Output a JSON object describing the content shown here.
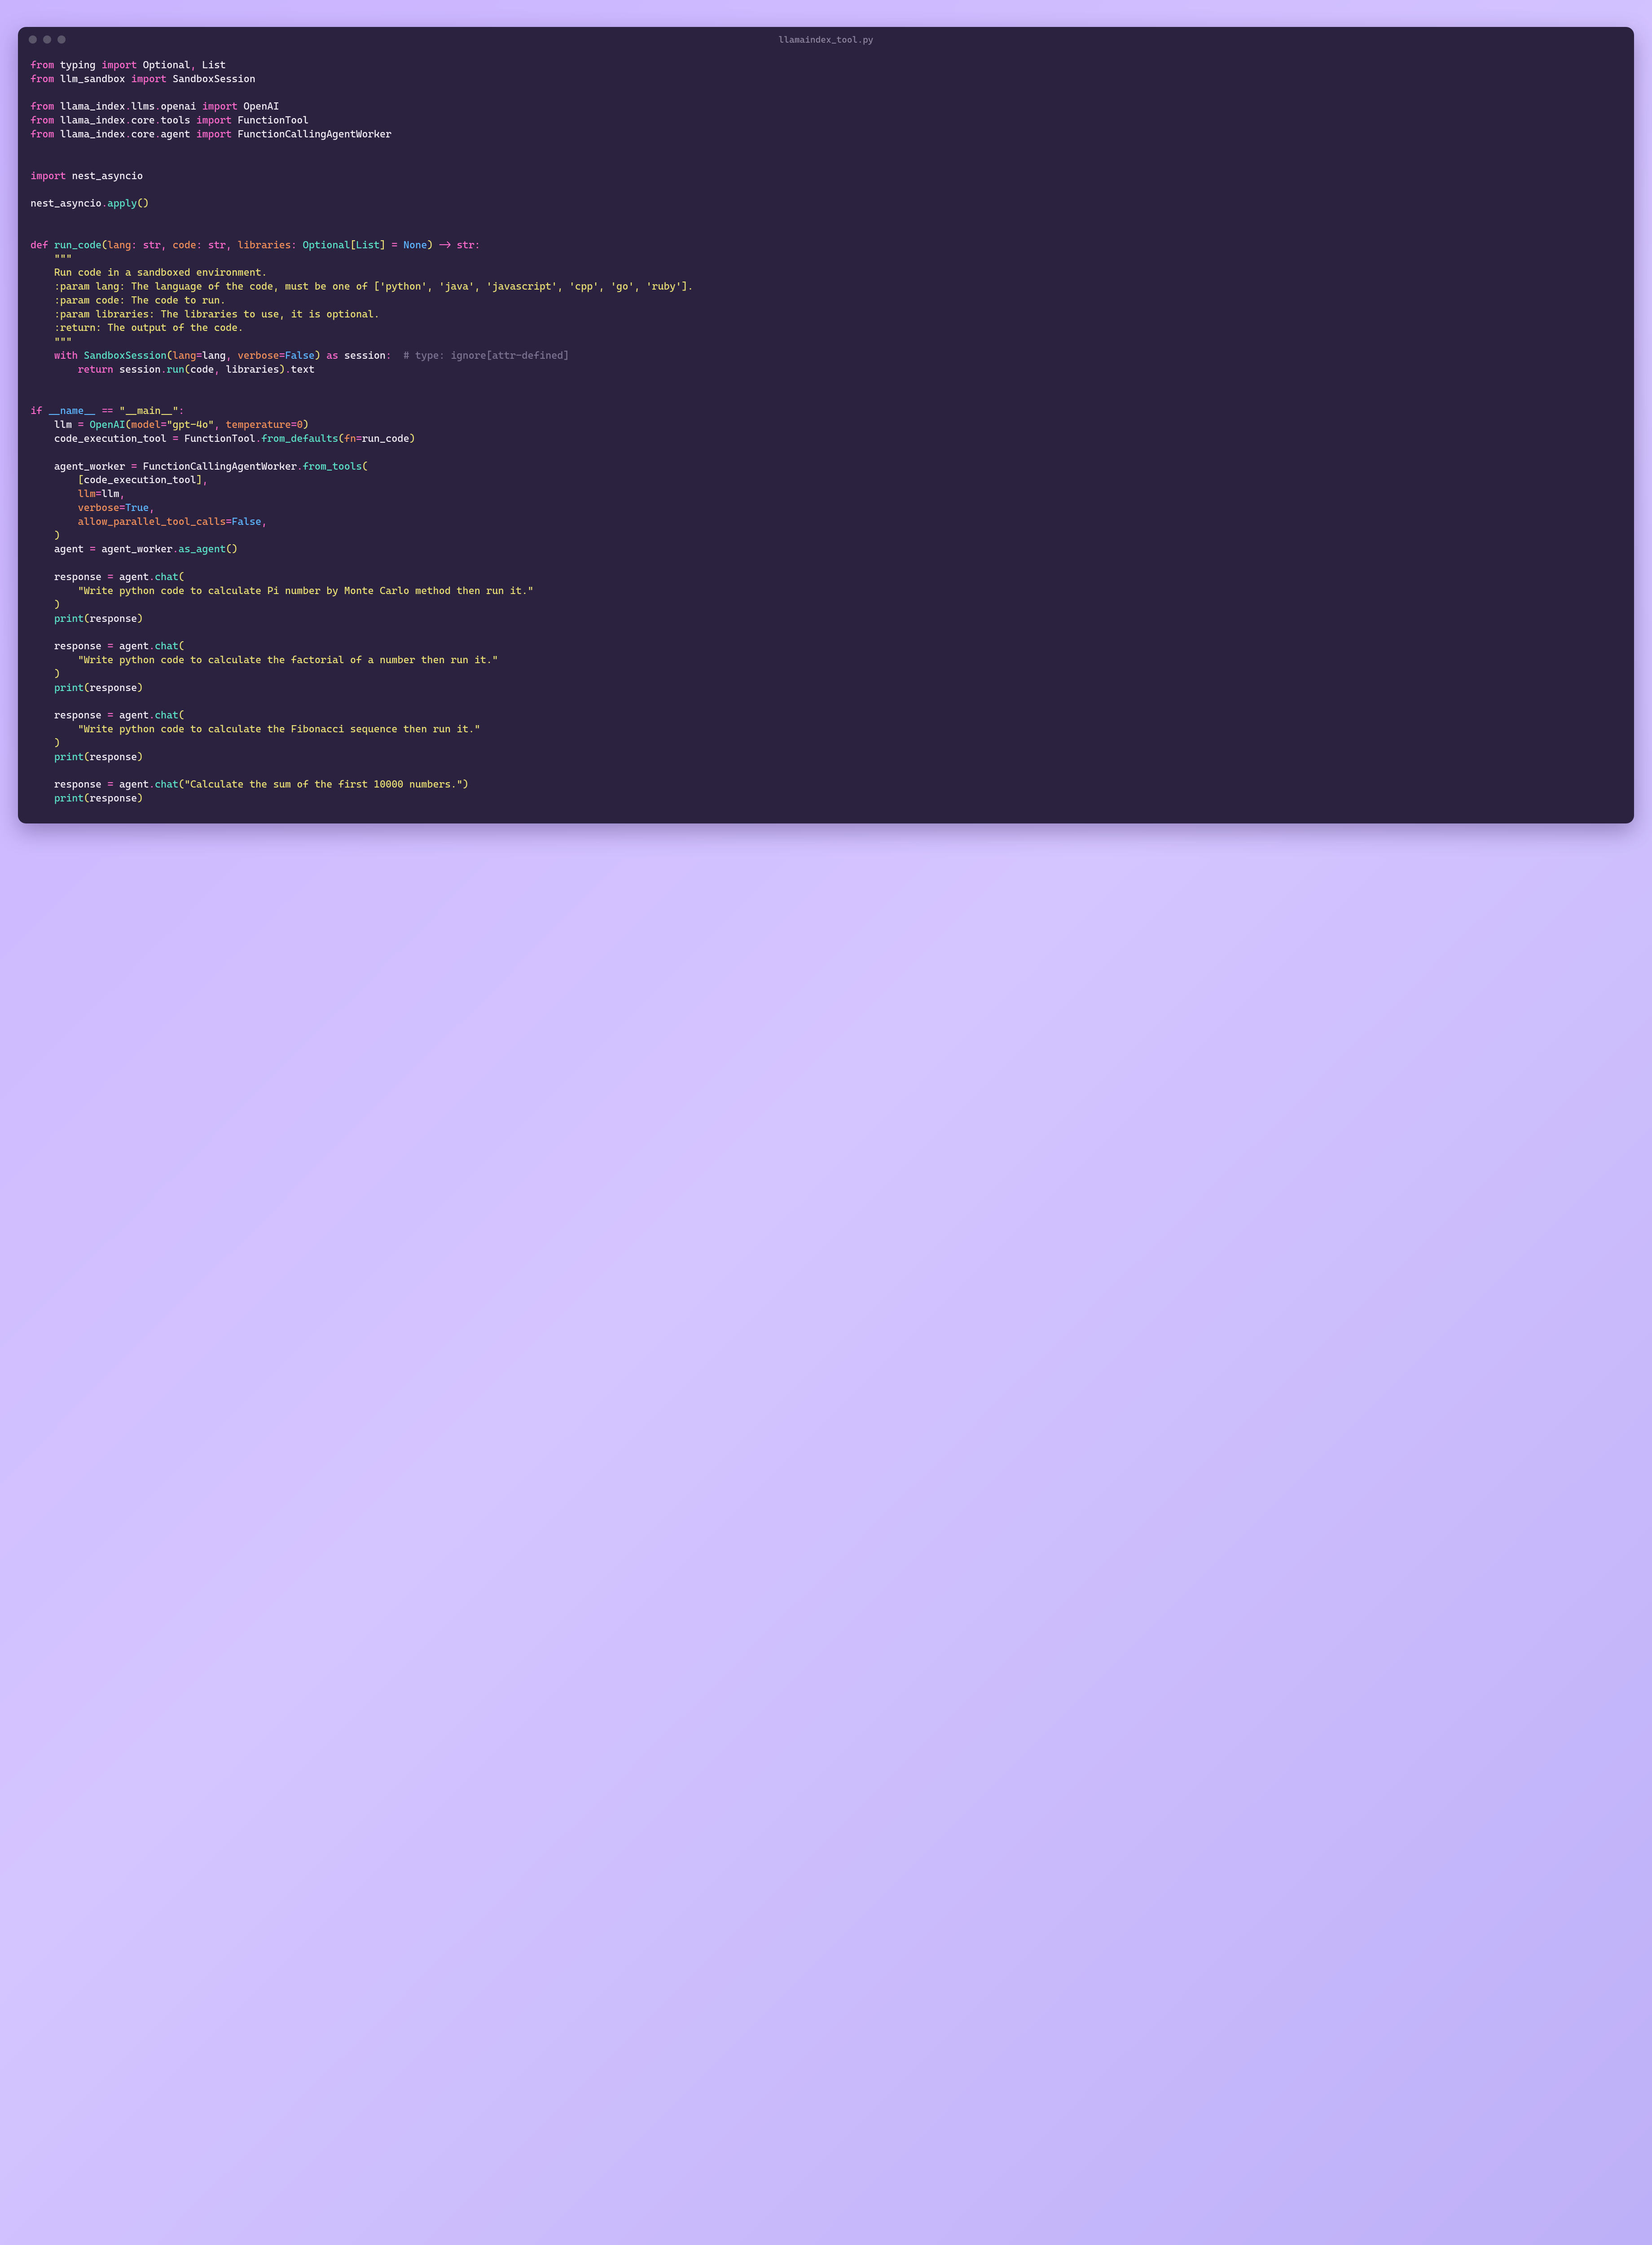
{
  "window": {
    "title": "llamaindex_tool.py"
  },
  "tokens": {
    "kw_from": "from",
    "kw_import": "import",
    "kw_def": "def",
    "kw_return": "return",
    "kw_with": "with",
    "kw_as": "as",
    "kw_if": "if",
    "typing": "typing",
    "Optional": "Optional",
    "List": "List",
    "llm_sandbox": "llm_sandbox",
    "SandboxSession": "SandboxSession",
    "llama_index": "llama_index",
    "llms": "llms",
    "openai_mod": "openai",
    "OpenAI": "OpenAI",
    "core": "core",
    "tools": "tools",
    "FunctionTool": "FunctionTool",
    "agent_mod": "agent",
    "FunctionCallingAgentWorker": "FunctionCallingAgentWorker",
    "nest_asyncio": "nest_asyncio",
    "apply": "apply",
    "run_code": "run_code",
    "lang": "lang",
    "code": "code",
    "libraries": "libraries",
    "builtin_str": "str",
    "None": "None",
    "doc1": "    Run code in a sandboxed environment.",
    "doc2": "    :param lang: The language of the code, must be one of ['python', 'java', 'javascript', 'cpp', 'go', 'ruby'].",
    "doc3": "    :param code: The code to run.",
    "doc4": "    :param libraries: The libraries to use, it is optional.",
    "doc5": "    :return: The output of the code.",
    "triple_open": "    \"\"\"",
    "triple_close": "    \"\"\"",
    "verbose": "verbose",
    "False": "False",
    "True": "True",
    "session": "session",
    "run": "run",
    "text": "text",
    "type_ignore": "# type: ignore[attr-defined]",
    "dunder_name": "__name__",
    "dunder_main": "\"__main__\"",
    "llm": "llm",
    "model_kw": "model",
    "model_val": "\"gpt-4o\"",
    "temperature": "temperature",
    "code_execution_tool": "code_execution_tool",
    "from_defaults": "from_defaults",
    "fn_kw": "fn",
    "agent_worker": "agent_worker",
    "from_tools": "from_tools",
    "allow_parallel_tool_calls": "allow_parallel_tool_calls",
    "as_agent": "as_agent",
    "agent": "agent",
    "response": "response",
    "chat": "chat",
    "print": "print",
    "q1": "\"Write python code to calculate Pi number by Monte Carlo method then run it.\"",
    "q2": "\"Write python code to calculate the factorial of a number then run it.\"",
    "q3": "\"Write python code to calculate the Fibonacci sequence then run it.\"",
    "q4": "\"Calculate the sum of the first 10000 numbers.\"",
    "zero": "0"
  }
}
